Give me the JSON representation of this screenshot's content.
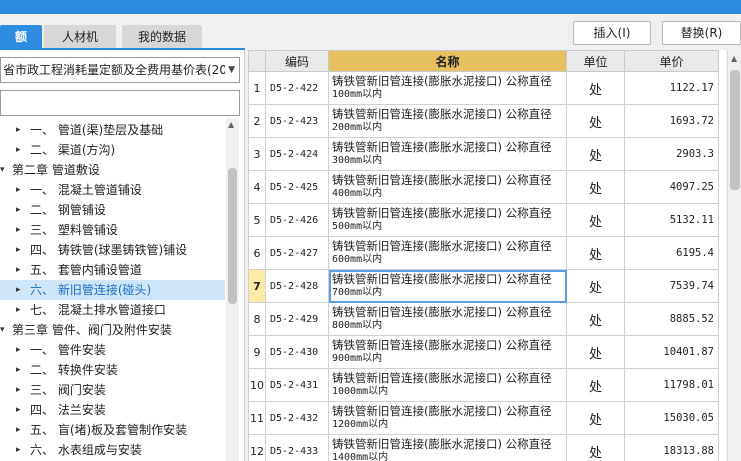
{
  "tabs": [
    {
      "label": "额",
      "active": true
    },
    {
      "label": "人材机",
      "active": false
    },
    {
      "label": "我的数据",
      "active": false
    }
  ],
  "toolbar": {
    "insert_label": "插入(I)",
    "replace_label": "替换(R)"
  },
  "library_select": {
    "value": "省市政工程消耗量定额及全费用基价表(20"
  },
  "search": {
    "placeholder": ""
  },
  "tree": [
    {
      "label": "一、 管道(渠)垫层及基础",
      "indent": 1,
      "arrow": "▸",
      "selected": false
    },
    {
      "label": "二、 渠道(方沟)",
      "indent": 1,
      "arrow": "▸",
      "selected": false
    },
    {
      "label": "第二章 管道敷设",
      "indent": 0,
      "arrow": "▾",
      "selected": false
    },
    {
      "label": "一、 混凝土管道铺设",
      "indent": 1,
      "arrow": "▸",
      "selected": false
    },
    {
      "label": "二、 钢管铺设",
      "indent": 1,
      "arrow": "▸",
      "selected": false
    },
    {
      "label": "三、 塑料管铺设",
      "indent": 1,
      "arrow": "▸",
      "selected": false
    },
    {
      "label": "四、 铸铁管(球墨铸铁管)铺设",
      "indent": 1,
      "arrow": "▸",
      "selected": false
    },
    {
      "label": "五、 套管内铺设管道",
      "indent": 1,
      "arrow": "▸",
      "selected": false
    },
    {
      "label": "六、 新旧管连接(碰头)",
      "indent": 1,
      "arrow": "▸",
      "selected": true
    },
    {
      "label": "七、 混凝土排水管道接口",
      "indent": 1,
      "arrow": "▸",
      "selected": false
    },
    {
      "label": "第三章 管件、阀门及附件安装",
      "indent": 0,
      "arrow": "▾",
      "selected": false
    },
    {
      "label": "一、 管件安装",
      "indent": 1,
      "arrow": "▸",
      "selected": false
    },
    {
      "label": "二、 转换件安装",
      "indent": 1,
      "arrow": "▸",
      "selected": false
    },
    {
      "label": "三、 阀门安装",
      "indent": 1,
      "arrow": "▸",
      "selected": false
    },
    {
      "label": "四、 法兰安装",
      "indent": 1,
      "arrow": "▸",
      "selected": false
    },
    {
      "label": "五、 盲(堵)板及套管制作安装",
      "indent": 1,
      "arrow": "▸",
      "selected": false
    },
    {
      "label": "六、 水表组成与安装",
      "indent": 1,
      "arrow": "▸",
      "selected": false
    }
  ],
  "grid": {
    "headers": {
      "num": "",
      "code": "编码",
      "name": "名称",
      "unit": "单位",
      "price": "单价"
    },
    "rows": [
      {
        "num": "1",
        "code": "D5-2-422",
        "name": "铸铁管新旧管连接(膨胀水泥接口) 公称直径",
        "size": "100mm以内",
        "unit": "处",
        "price": "1122.17",
        "current": false
      },
      {
        "num": "2",
        "code": "D5-2-423",
        "name": "铸铁管新旧管连接(膨胀水泥接口) 公称直径",
        "size": "200mm以内",
        "unit": "处",
        "price": "1693.72",
        "current": false
      },
      {
        "num": "3",
        "code": "D5-2-424",
        "name": "铸铁管新旧管连接(膨胀水泥接口) 公称直径",
        "size": "300mm以内",
        "unit": "处",
        "price": "2903.3",
        "current": false
      },
      {
        "num": "4",
        "code": "D5-2-425",
        "name": "铸铁管新旧管连接(膨胀水泥接口) 公称直径",
        "size": "400mm以内",
        "unit": "处",
        "price": "4097.25",
        "current": false
      },
      {
        "num": "5",
        "code": "D5-2-426",
        "name": "铸铁管新旧管连接(膨胀水泥接口) 公称直径",
        "size": "500mm以内",
        "unit": "处",
        "price": "5132.11",
        "current": false
      },
      {
        "num": "6",
        "code": "D5-2-427",
        "name": "铸铁管新旧管连接(膨胀水泥接口) 公称直径",
        "size": "600mm以内",
        "unit": "处",
        "price": "6195.4",
        "current": false
      },
      {
        "num": "7",
        "code": "D5-2-428",
        "name": "铸铁管新旧管连接(膨胀水泥接口) 公称直径",
        "size": "700mm以内",
        "unit": "处",
        "price": "7539.74",
        "current": true
      },
      {
        "num": "8",
        "code": "D5-2-429",
        "name": "铸铁管新旧管连接(膨胀水泥接口) 公称直径",
        "size": "800mm以内",
        "unit": "处",
        "price": "8885.52",
        "current": false
      },
      {
        "num": "9",
        "code": "D5-2-430",
        "name": "铸铁管新旧管连接(膨胀水泥接口) 公称直径",
        "size": "900mm以内",
        "unit": "处",
        "price": "10401.87",
        "current": false
      },
      {
        "num": "10",
        "code": "D5-2-431",
        "name": "铸铁管新旧管连接(膨胀水泥接口) 公称直径",
        "size": "1000mm以内",
        "unit": "处",
        "price": "11798.01",
        "current": false
      },
      {
        "num": "11",
        "code": "D5-2-432",
        "name": "铸铁管新旧管连接(膨胀水泥接口) 公称直径",
        "size": "1200mm以内",
        "unit": "处",
        "price": "15030.05",
        "current": false
      },
      {
        "num": "12",
        "code": "D5-2-433",
        "name": "铸铁管新旧管连接(膨胀水泥接口) 公称直径",
        "size": "1400mm以内",
        "unit": "处",
        "price": "18313.88",
        "current": false
      }
    ]
  }
}
